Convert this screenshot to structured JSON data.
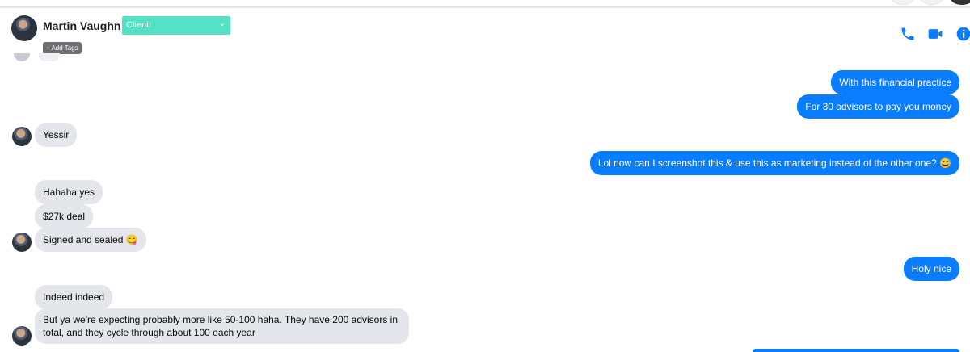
{
  "contact": {
    "name": "Martin Vaughn",
    "tag": "Client!",
    "add_tags": "+ Add Tags"
  },
  "colors": {
    "outgoing": "#0a7cff",
    "incoming": "#e4e6eb",
    "tag": "#55e1c5",
    "icons": "#0a7cff"
  },
  "header_icons": [
    "phone-icon",
    "video-icon",
    "info-icon"
  ],
  "messages": {
    "m1": "With this financial practice",
    "m2": "For 30 advisors to pay you money",
    "m3": "Yessir",
    "m4": "Lol now can I screenshot this & use this as marketing instead of the other one? 😅",
    "m5": "Hahaha yes",
    "m6": "$27k deal",
    "m7": "Signed and sealed 😋",
    "m8": "Holy nice",
    "m9": "Indeed indeed",
    "m10": "But ya we're expecting probably more like 50-100 haha. They have 200 advisors in total, and they cycle through about 100 each year"
  }
}
